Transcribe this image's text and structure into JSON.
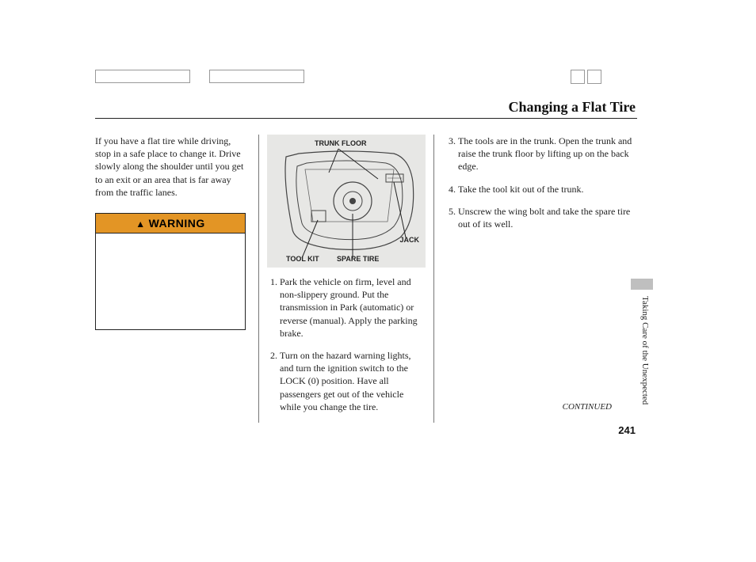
{
  "title": "Changing a Flat Tire",
  "intro": "If you have a flat tire while driving, stop in a safe place to change it. Drive slowly along the shoulder until you get to an exit or an area that is far away from the traffic lanes.",
  "warning_label": "WARNING",
  "diagram": {
    "trunk_floor": "TRUNK FLOOR",
    "jack": "JACK",
    "tool_kit": "TOOL KIT",
    "spare_tire": "SPARE TIRE"
  },
  "steps_col2": {
    "s1": "Park the vehicle on firm, level and non-slippery ground. Put the transmission in Park (automatic) or reverse (manual). Apply the parking brake.",
    "s2": "Turn on the hazard warning lights, and turn the ignition switch to the LOCK (0) position. Have all passengers get out of the vehicle while you change the tire."
  },
  "steps_col3": {
    "s3": "The tools are in the trunk. Open the trunk and raise the trunk floor by lifting up on the back edge.",
    "s4": "Take the tool kit out of the trunk.",
    "s5": "Unscrew the wing bolt and take the spare tire out of its well."
  },
  "side_section": "Taking Care of the Unexpected",
  "continued": "CONTINUED",
  "page_number": "241"
}
